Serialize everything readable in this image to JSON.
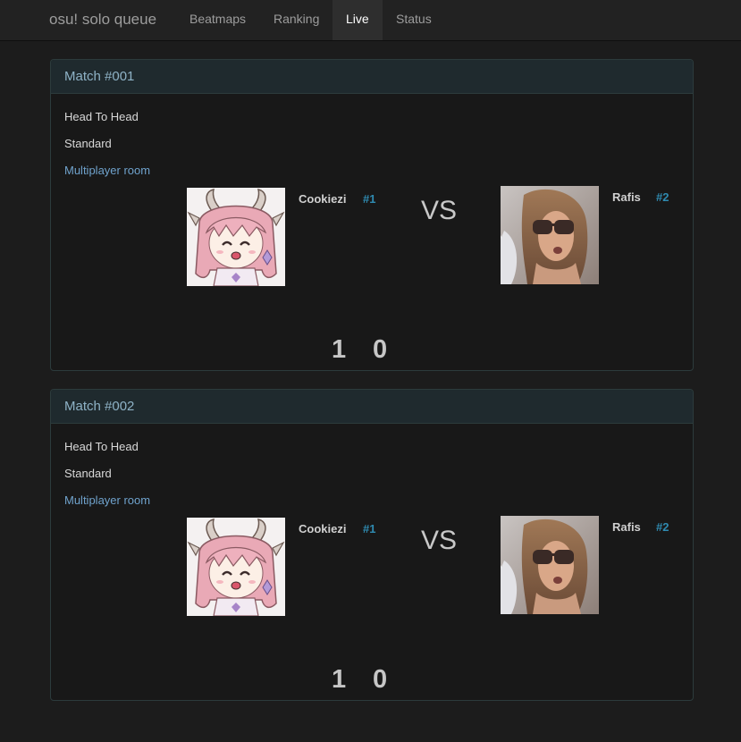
{
  "nav": {
    "brand": "osu! solo queue",
    "items": [
      {
        "label": "Beatmaps",
        "active": false
      },
      {
        "label": "Ranking",
        "active": false
      },
      {
        "label": "Live",
        "active": true
      },
      {
        "label": "Status",
        "active": false
      }
    ]
  },
  "matches": [
    {
      "title": "Match #001",
      "mode": "Head To Head",
      "ruleset": "Standard",
      "room_link": "Multiplayer room",
      "vs_label": "VS",
      "player1": {
        "name": "Cookiezi",
        "rank": "#1",
        "avatar": "anime-girl-avatar"
      },
      "player2": {
        "name": "Rafis",
        "rank": "#2",
        "avatar": "sunglasses-photo-avatar"
      },
      "score1": "1",
      "score2": "0"
    },
    {
      "title": "Match #002",
      "mode": "Head To Head",
      "ruleset": "Standard",
      "room_link": "Multiplayer room",
      "vs_label": "VS",
      "player1": {
        "name": "Cookiezi",
        "rank": "#1",
        "avatar": "anime-girl-avatar"
      },
      "player2": {
        "name": "Rafis",
        "rank": "#2",
        "avatar": "sunglasses-photo-avatar"
      },
      "score1": "1",
      "score2": "0"
    }
  ]
}
